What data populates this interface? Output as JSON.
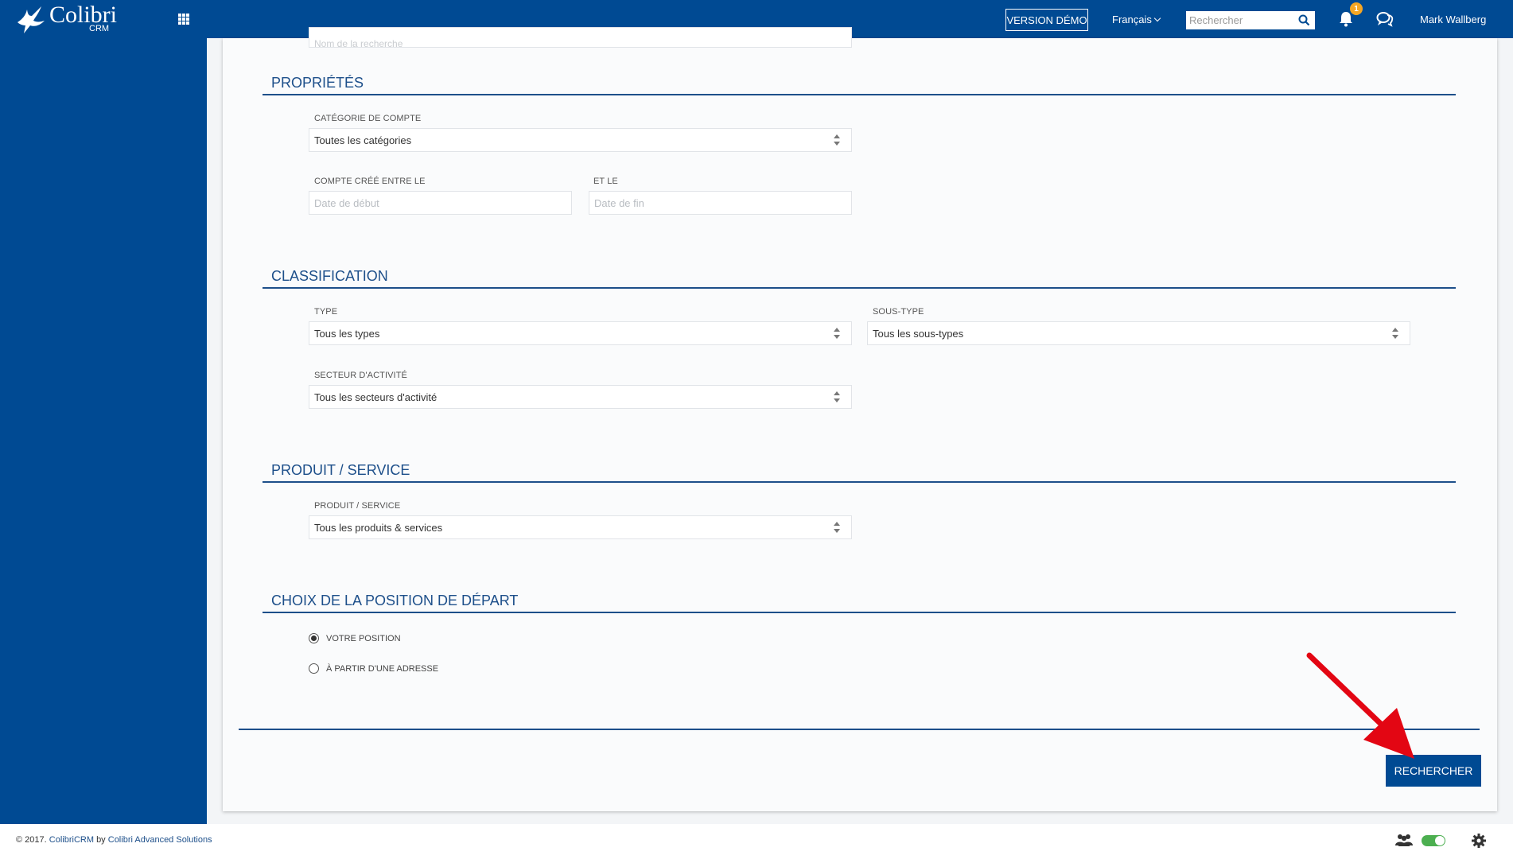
{
  "header": {
    "brand": "Colibri",
    "brand_sub": "CRM",
    "demo_label": "VERSION DÉMO",
    "language": "Français",
    "search_placeholder": "Rechercher",
    "notification_count": "1",
    "user_name": "Mark Wallberg"
  },
  "form": {
    "partial_field_text": "Nom de la recherche",
    "sections": {
      "properties": {
        "title": "PROPRIÉTÉS",
        "account_category_label": "CATÉGORIE DE COMPTE",
        "account_category_value": "Toutes les catégories",
        "created_between_label": "COMPTE CRÉÉ ENTRE LE",
        "start_placeholder": "Date de début",
        "and_label": "ET LE",
        "end_placeholder": "Date de fin"
      },
      "classification": {
        "title": "CLASSIFICATION",
        "type_label": "TYPE",
        "type_value": "Tous les types",
        "subtype_label": "SOUS-TYPE",
        "subtype_value": "Tous les sous-types",
        "sector_label": "SECTEUR D'ACTIVITÉ",
        "sector_value": "Tous les secteurs d'activité"
      },
      "product": {
        "title": "PRODUIT / SERVICE",
        "product_label": "PRODUIT / SERVICE",
        "product_value": "Tous les produits & services"
      },
      "start_position": {
        "title": "CHOIX DE LA POSITION DE DÉPART",
        "option_current": "VOTRE POSITION",
        "option_address": "À PARTIR D'UNE ADRESSE",
        "selected": "VOTRE POSITION"
      }
    },
    "submit_label": "RECHERCHER"
  },
  "footer": {
    "copyright_prefix": "© 2017.",
    "product_link": "ColibriCRM",
    "by_text": "by",
    "company_link": "Colibri Advanced Solutions"
  },
  "colors": {
    "brand_blue": "#004a93",
    "section_blue": "#1d4f8a",
    "badge": "#f5a623",
    "annotation_arrow": "#e30613",
    "toggle_on": "#4caf50"
  }
}
